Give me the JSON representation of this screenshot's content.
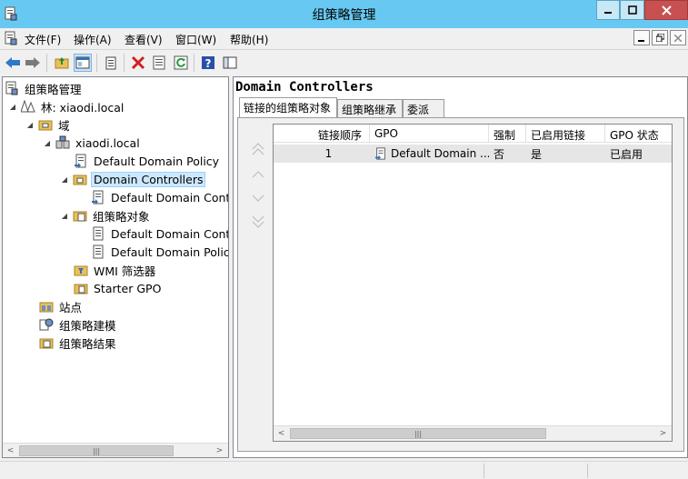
{
  "window": {
    "title": "组策略管理",
    "controls": {
      "minimize": "minimize-icon",
      "maximize": "maximize-icon",
      "close": "close-icon"
    }
  },
  "menu": {
    "items": [
      "文件(F)",
      "操作(A)",
      "查看(V)",
      "窗口(W)",
      "帮助(H)"
    ]
  },
  "toolbar": {
    "buttons": [
      "back-icon",
      "forward-icon",
      "up-folder-icon",
      "show-tree-icon",
      "export-icon",
      "delete-icon",
      "properties-icon",
      "refresh-icon",
      "help-icon",
      "console-icon"
    ]
  },
  "tree": {
    "root": "组策略管理",
    "forest": "林: xiaodi.local",
    "domains": "域",
    "domain": "xiaodi.local",
    "default_domain_policy": "Default Domain Policy",
    "domain_controllers": "Domain Controllers",
    "dc_child": "Default Domain Contr",
    "gpo_container": "组策略对象",
    "gpo_child_1": "Default Domain Contr",
    "gpo_child_2": "Default Domain Policy",
    "wmi_filters": "WMI 筛选器",
    "starter_gpo": "Starter GPO",
    "sites": "站点",
    "modeling": "组策略建模",
    "results": "组策略结果"
  },
  "right": {
    "title": "Domain Controllers",
    "tabs": [
      "链接的组策略对象",
      "组策略继承",
      "委派"
    ],
    "active_tab": 0,
    "columns": [
      "链接顺序",
      "GPO",
      "强制",
      "已启用链接",
      "GPO 状态"
    ],
    "rows": [
      {
        "order": "1",
        "gpo": "Default Domain ...",
        "enforced": "否",
        "link_enabled": "是",
        "status": "已启用"
      }
    ]
  },
  "colors": {
    "titlebar": "#67c9f2",
    "selection": "#cce8ff",
    "close_button": "#c75050"
  }
}
